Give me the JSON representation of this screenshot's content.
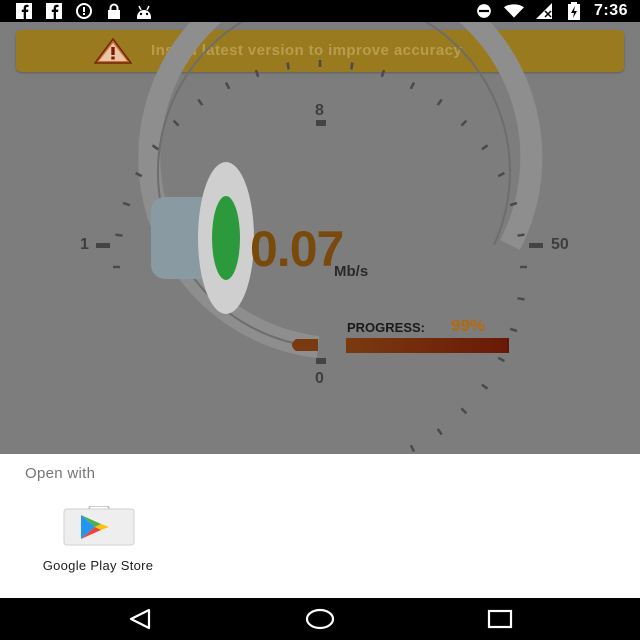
{
  "status_bar": {
    "time": "7:36",
    "left_icons": [
      "facebook-icon",
      "facebook-icon",
      "alarm-icon",
      "lock-icon",
      "android-icon"
    ],
    "right_icons": [
      "do-not-disturb-icon",
      "wifi-icon",
      "signal-icon",
      "battery-charging-icon"
    ]
  },
  "banner": {
    "text": "Install latest version to improve accuracy",
    "icon": "warning-icon",
    "color": "#9a7a1e"
  },
  "gauge": {
    "speed_value": "0.07",
    "speed_unit": "Mb/s",
    "label_min": "0",
    "label_low": "1",
    "label_mid": "8",
    "label_max": "50",
    "progress_label": "PROGRESS:",
    "progress_percent": "99%",
    "progress_fraction": 0.99,
    "accent_color": "#7a4a0c"
  },
  "open_with": {
    "title": "Open with",
    "apps": [
      {
        "label": "Google Play Store",
        "icon": "google-play-store-icon"
      }
    ]
  },
  "nav_bar": {
    "buttons": [
      "back-icon",
      "home-icon",
      "recents-icon"
    ]
  }
}
